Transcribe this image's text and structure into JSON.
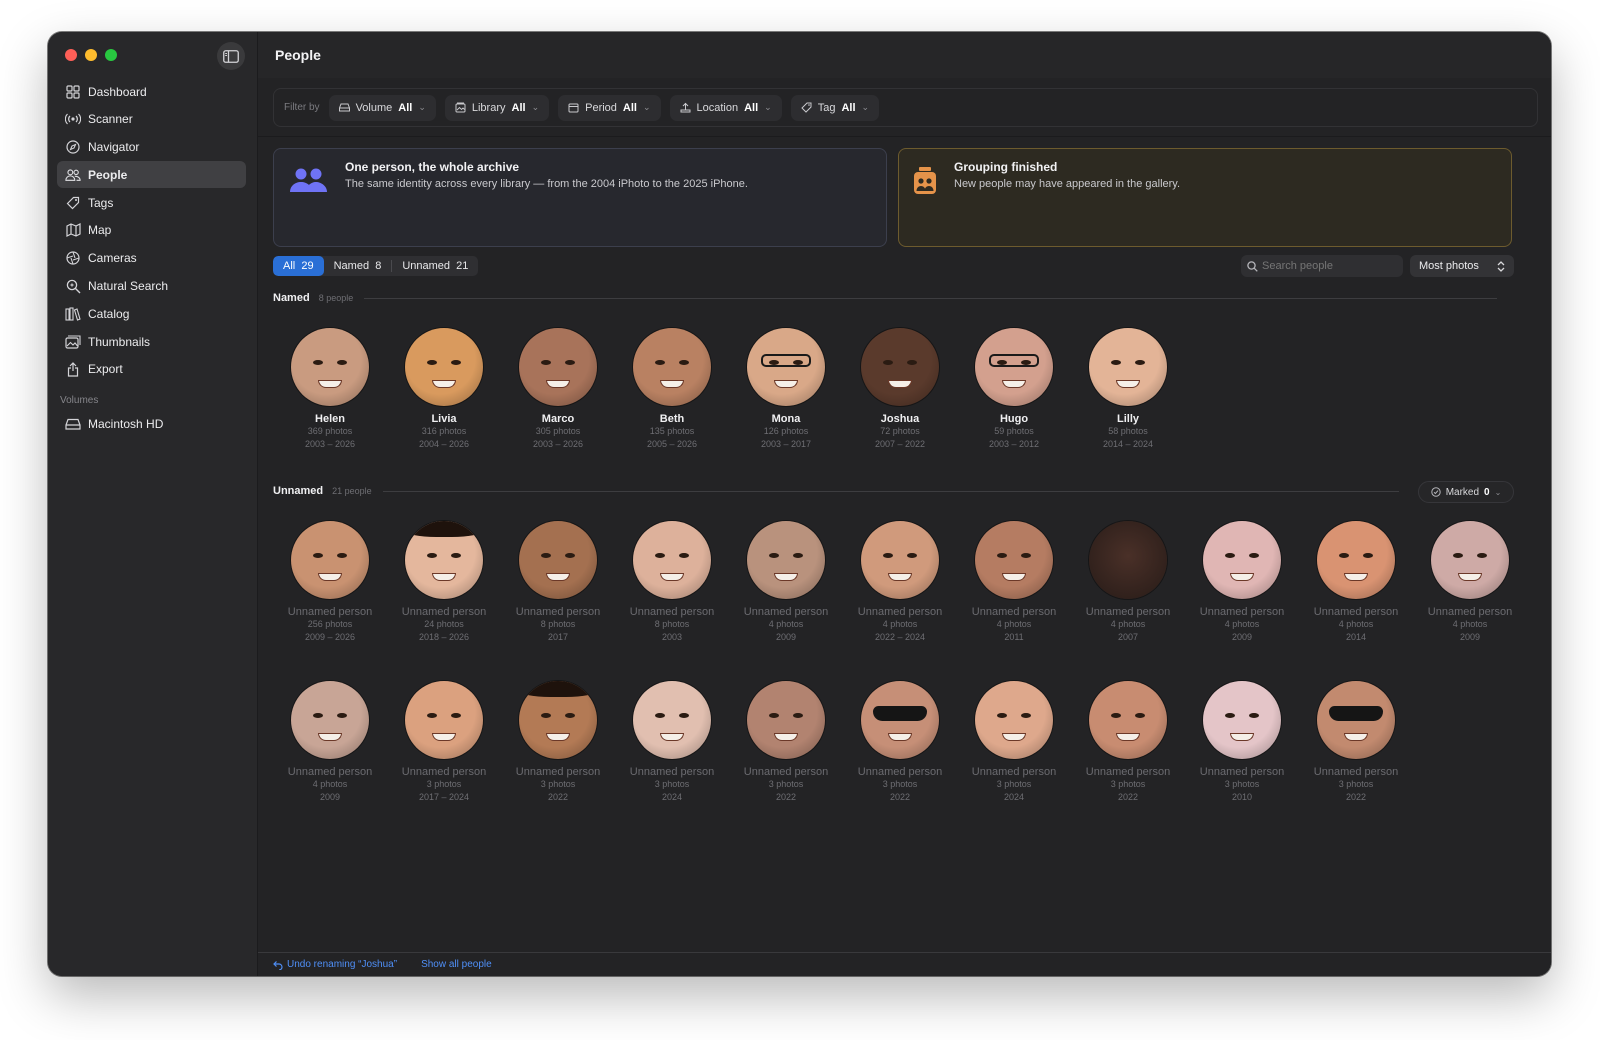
{
  "window": {
    "title": "People"
  },
  "sidebar": {
    "items": [
      {
        "label": "Dashboard",
        "icon": "grid-icon"
      },
      {
        "label": "Scanner",
        "icon": "broadcast-icon"
      },
      {
        "label": "Navigator",
        "icon": "compass-icon"
      },
      {
        "label": "People",
        "icon": "people-icon",
        "active": true
      },
      {
        "label": "Tags",
        "icon": "tag-icon"
      },
      {
        "label": "Map",
        "icon": "map-icon"
      },
      {
        "label": "Cameras",
        "icon": "aperture-icon"
      },
      {
        "label": "Natural Search",
        "icon": "magnify-sparkle-icon"
      },
      {
        "label": "Catalog",
        "icon": "books-icon"
      },
      {
        "label": "Thumbnails",
        "icon": "photos-icon"
      },
      {
        "label": "Export",
        "icon": "share-icon"
      }
    ],
    "volumes_heading": "Volumes",
    "volumes": [
      {
        "label": "Macintosh HD",
        "icon": "drive-icon"
      }
    ]
  },
  "filters": {
    "label": "Filter by",
    "chips": [
      {
        "name": "Volume",
        "value": "All"
      },
      {
        "name": "Library",
        "value": "All"
      },
      {
        "name": "Period",
        "value": "All"
      },
      {
        "name": "Location",
        "value": "All"
      },
      {
        "name": "Tag",
        "value": "All"
      }
    ]
  },
  "banners": {
    "left": {
      "title": "One person, the whole archive",
      "text": "The same identity across every library — from the 2004 iPhoto to the 2025 iPhone."
    },
    "right": {
      "title": "Grouping finished",
      "text": "New people may have appeared in the gallery."
    }
  },
  "segments": [
    {
      "label": "All",
      "count": "29",
      "on": true
    },
    {
      "label": "Named",
      "count": "8"
    },
    {
      "label": "Unnamed",
      "count": "21"
    }
  ],
  "search": {
    "placeholder": "Search people"
  },
  "sort": {
    "label": "Most photos"
  },
  "named": {
    "title": "Named",
    "count": "8 people",
    "people": [
      {
        "name": "Helen",
        "photos": "369 photos",
        "years": "2003 – 2026",
        "skin": "#c99b80"
      },
      {
        "name": "Livia",
        "photos": "316 photos",
        "years": "2004 – 2026",
        "skin": "#d99a5e"
      },
      {
        "name": "Marco",
        "photos": "305 photos",
        "years": "2003 – 2026",
        "skin": "#a8735a"
      },
      {
        "name": "Beth",
        "photos": "135 photos",
        "years": "2005 – 2026",
        "skin": "#b98162"
      },
      {
        "name": "Mona",
        "photos": "126 photos",
        "years": "2003 – 2017",
        "skin": "#d9a888",
        "glasses": true
      },
      {
        "name": "Joshua",
        "photos": "72 photos",
        "years": "2007 – 2022",
        "skin": "#5a3a2c"
      },
      {
        "name": "Hugo",
        "photos": "59 photos",
        "years": "2003 – 2012",
        "skin": "#d3a08e",
        "glasses": true
      },
      {
        "name": "Lilly",
        "photos": "58 photos",
        "years": "2014 – 2024",
        "skin": "#e3b497"
      }
    ]
  },
  "unnamed": {
    "title": "Unnamed",
    "count": "21 people",
    "marked_label": "Marked",
    "marked_count": "0",
    "rows": [
      [
        {
          "name": "Unnamed person",
          "photos": "256 photos",
          "years": "2009 – 2026",
          "skin": "#c99271"
        },
        {
          "name": "Unnamed person",
          "photos": "24 photos",
          "years": "2018 – 2026",
          "skin": "#e4b79d",
          "hair": true
        },
        {
          "name": "Unnamed person",
          "photos": "8 photos",
          "years": "2017",
          "skin": "#a47050"
        },
        {
          "name": "Unnamed person",
          "photos": "8 photos",
          "years": "2003",
          "skin": "#ddb19b"
        },
        {
          "name": "Unnamed person",
          "photos": "4 photos",
          "years": "2009",
          "skin": "#b9927d"
        },
        {
          "name": "Unnamed person",
          "photos": "4 photos",
          "years": "2022 – 2024",
          "skin": "#d09a7c"
        },
        {
          "name": "Unnamed person",
          "photos": "4 photos",
          "years": "2011",
          "skin": "#b57c62"
        },
        {
          "name": "Unnamed person",
          "photos": "4 photos",
          "years": "2007",
          "skin": "#4a3028",
          "dark": true
        },
        {
          "name": "Unnamed person",
          "photos": "4 photos",
          "years": "2009",
          "skin": "#e0b6b4"
        },
        {
          "name": "Unnamed person",
          "photos": "4 photos",
          "years": "2014",
          "skin": "#d99372"
        },
        {
          "name": "Unnamed person",
          "photos": "4 photos",
          "years": "2009",
          "skin": "#ceaaa6"
        }
      ],
      [
        {
          "name": "Unnamed person",
          "photos": "4 photos",
          "years": "2009",
          "skin": "#c8a596"
        },
        {
          "name": "Unnamed person",
          "photos": "3 photos",
          "years": "2017 – 2024",
          "skin": "#dba17f"
        },
        {
          "name": "Unnamed person",
          "photos": "3 photos",
          "years": "2022",
          "skin": "#b37a55",
          "hair": true
        },
        {
          "name": "Unnamed person",
          "photos": "3 photos",
          "years": "2024",
          "skin": "#e1bfb0"
        },
        {
          "name": "Unnamed person",
          "photos": "3 photos",
          "years": "2022",
          "skin": "#b28370"
        },
        {
          "name": "Unnamed person",
          "photos": "3 photos",
          "years": "2022",
          "skin": "#c68f77",
          "shades": true
        },
        {
          "name": "Unnamed person",
          "photos": "3 photos",
          "years": "2024",
          "skin": "#dea88c"
        },
        {
          "name": "Unnamed person",
          "photos": "3 photos",
          "years": "2022",
          "skin": "#c88c71"
        },
        {
          "name": "Unnamed person",
          "photos": "3 photos",
          "years": "2010",
          "skin": "#e4c5c8"
        },
        {
          "name": "Unnamed person",
          "photos": "3 photos",
          "years": "2022",
          "skin": "#c28a6f",
          "shades": true
        }
      ]
    ]
  },
  "footer": {
    "undo": "Undo renaming “Joshua”",
    "show_all": "Show all people"
  }
}
